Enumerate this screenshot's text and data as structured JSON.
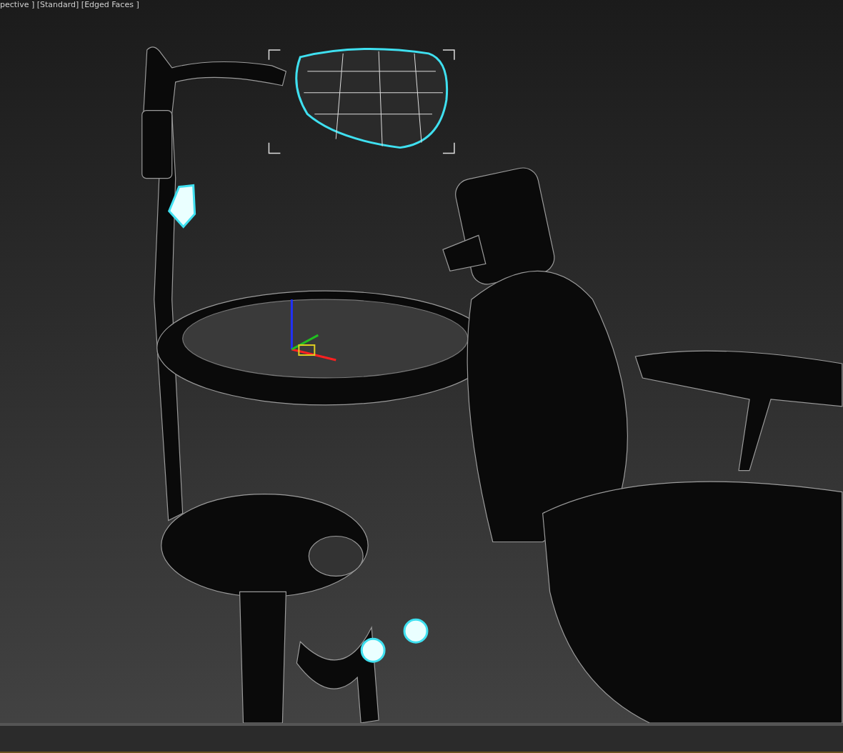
{
  "viewport": {
    "label": "pective ] [Standard] [Edged Faces ]"
  }
}
